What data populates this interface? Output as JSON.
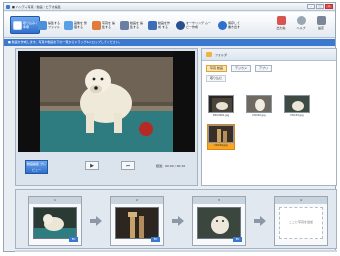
{
  "window": {
    "title": "■ ハンディ写真・動画・ビデオ編集"
  },
  "toolbar": {
    "tools": [
      {
        "label": "取り込み / 準備"
      },
      {
        "label": "編集する ファイル"
      },
      {
        "label": "画像を 整理する"
      },
      {
        "label": "写真を 編集する"
      },
      {
        "label": "動画を 編集する"
      },
      {
        "label": "動画を作成 する"
      },
      {
        "label": "オーサリング ムービー作成"
      },
      {
        "label": "保存して 書き出す"
      }
    ],
    "right_tools": [
      {
        "label": "出力先"
      },
      {
        "label": "ヘルプ"
      },
      {
        "label": "設定"
      }
    ],
    "accent": "#2f6fce"
  },
  "infobar": {
    "text": "■ 動画を作成します。写真や動画を下の一覧からドラッグ&ドロップしてください。"
  },
  "video_panel": {
    "badge": "動画編集 プレビュー",
    "play": "▶",
    "skip": "⏮",
    "time": "経過：00:00 / 00:10"
  },
  "folder_panel": {
    "header": "フォルダ",
    "tabs": [
      {
        "label": "写真 動画"
      },
      {
        "label": "デジカメ"
      },
      {
        "label": "アプリ"
      }
    ],
    "import_label": "取り込む",
    "thumbs": [
      {
        "caption": "DSC0001.jpg"
      },
      {
        "caption": "DSC02.jpg"
      },
      {
        "caption": "DSC03.jpg"
      },
      {
        "caption": "DSC04.jpg"
      }
    ]
  },
  "storyboard": {
    "slots": [
      {
        "num": "1",
        "tag": "ED"
      },
      {
        "num": "2",
        "tag": "ED"
      },
      {
        "num": "3",
        "tag": "ED"
      },
      {
        "num": "4",
        "empty_text": "ここに写真を追加"
      }
    ]
  }
}
